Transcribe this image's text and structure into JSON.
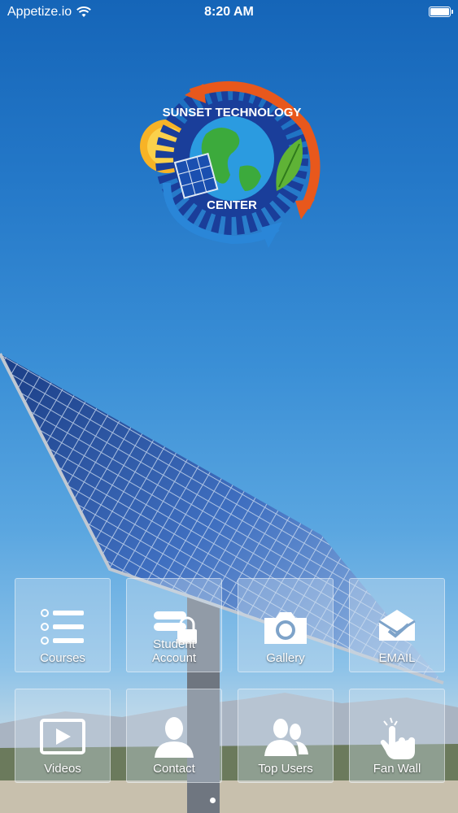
{
  "status_bar": {
    "carrier": "Appetize.io",
    "time": "8:20 AM"
  },
  "logo": {
    "top_text": "SUNSET TECHNOLOGY",
    "bottom_text": "CENTER"
  },
  "grid": {
    "tiles": [
      {
        "label": "Courses",
        "icon": "list-icon"
      },
      {
        "label": "Student\nAccount",
        "icon": "lock-icon"
      },
      {
        "label": "Gallery",
        "icon": "camera-icon"
      },
      {
        "label": "EMAIL",
        "icon": "mail-icon"
      },
      {
        "label": "Videos",
        "icon": "play-icon"
      },
      {
        "label": "Contact",
        "icon": "person-icon"
      },
      {
        "label": "Top Users",
        "icon": "users-icon"
      },
      {
        "label": "Fan Wall",
        "icon": "tap-icon"
      }
    ]
  },
  "colors": {
    "sky_top": "#1565b8",
    "sky_mid": "#3a8fd6",
    "tile_bg": "rgba(210,225,240,0.35)"
  }
}
